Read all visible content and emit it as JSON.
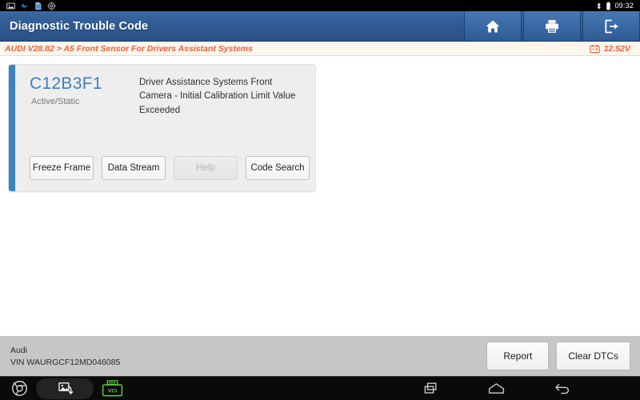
{
  "statusbar": {
    "icons_left": [
      "image-icon",
      "usb-pulse-icon",
      "sdcard-icon",
      "settings-gear-icon"
    ],
    "bluetooth_icon": "bluetooth-icon",
    "battery_icon": "battery-icon",
    "time": "09:32"
  },
  "header": {
    "title": "Diagnostic Trouble Code",
    "buttons": [
      {
        "name": "home-button",
        "icon": "home-icon"
      },
      {
        "name": "print-button",
        "icon": "printer-icon"
      },
      {
        "name": "exit-button",
        "icon": "exit-icon"
      }
    ]
  },
  "breadcrumb": {
    "path": "AUDI V28.82 > A5 Front Sensor For Drivers Assistant Systems",
    "battery_icon": "car-battery-icon",
    "voltage": "12.52V"
  },
  "dtc": {
    "code": "C12B3F1",
    "status": "Active/Static",
    "description": "Driver Assistance Systems Front Camera - Initial Calibration Limit Value Exceeded",
    "accent_color": "#3b82c4",
    "code_color": "#3f7fc1",
    "actions": [
      {
        "label": "Freeze Frame",
        "name": "freeze-frame-button",
        "disabled": false
      },
      {
        "label": "Data Stream",
        "name": "data-stream-button",
        "disabled": false
      },
      {
        "label": "Help",
        "name": "help-button",
        "disabled": true
      },
      {
        "label": "Code Search",
        "name": "code-search-button",
        "disabled": false
      }
    ]
  },
  "footer": {
    "vehicle_make": "Audi",
    "vin": "VIN WAURGCF12MD046085",
    "report_label": "Report",
    "clear_dtcs_label": "Clear DTCs"
  },
  "navbar": {
    "chrome_icon": "chrome-icon",
    "screenshot_icon": "screenshot-icon",
    "vci_icon": "vci-icon",
    "vci_label": "VCI",
    "vci_color": "#5bd13b",
    "recents_icon": "recents-icon",
    "home_icon": "home-outline-icon",
    "back_icon": "back-arrow-icon"
  }
}
